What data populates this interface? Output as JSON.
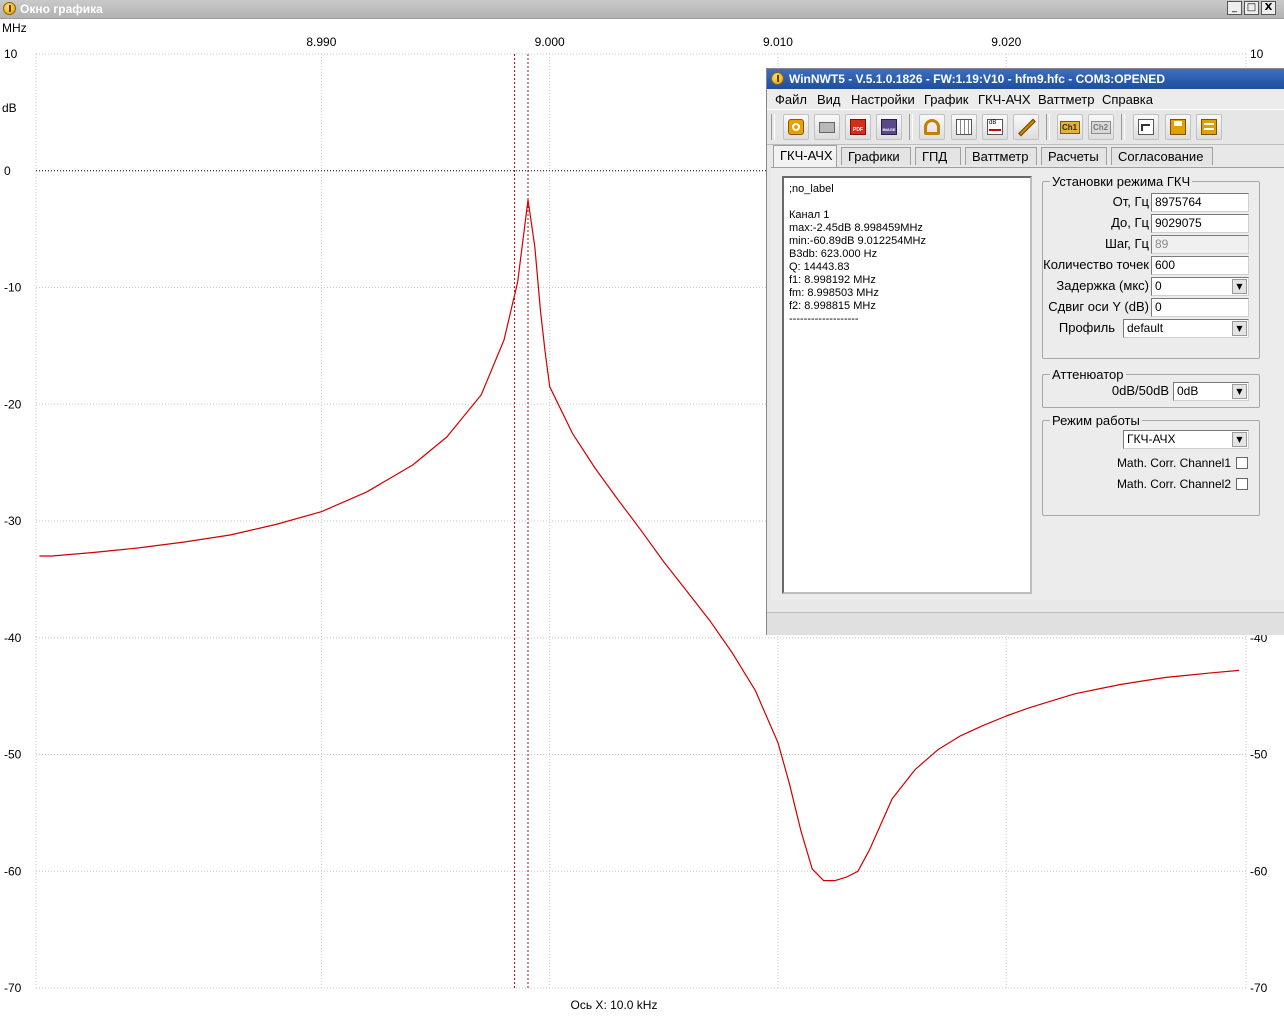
{
  "graph_window": {
    "title": "Окно графика",
    "controls": {
      "minimize": "_",
      "maximize": "□",
      "close": "X"
    }
  },
  "chart_data": {
    "type": "line",
    "x_unit_label": "MHz",
    "y_unit_label": "dB",
    "xlabel": "Ось X: 10.0 kHz",
    "xlim": [
      8.9775,
      9.0305
    ],
    "ylim": [
      -70,
      10
    ],
    "x_ticks": [
      8.99,
      9.0,
      9.01,
      9.02
    ],
    "x_tick_labels": [
      "8.990",
      "9.000",
      "9.010",
      "9.020"
    ],
    "y_ticks": [
      10,
      0,
      -10,
      -20,
      -30,
      -40,
      -50,
      -60,
      -70
    ],
    "y_tick_labels": [
      "10",
      "0",
      "-10",
      "-20",
      "-30",
      "-40",
      "-50",
      "-60",
      "-70"
    ],
    "grid": true,
    "markers_x": [
      8.99846,
      8.99905
    ],
    "series": [
      {
        "color": "#d00000",
        "x": [
          8.97765,
          8.9782,
          8.98,
          8.982,
          8.984,
          8.986,
          8.988,
          8.99,
          8.992,
          8.994,
          8.9955,
          8.997,
          8.998,
          8.9986,
          8.99905,
          8.99935,
          8.9996,
          8.9998,
          9.0,
          9.001,
          9.002,
          9.003,
          9.004,
          9.005,
          9.006,
          9.007,
          9.008,
          9.009,
          9.01,
          9.0105,
          9.011,
          9.0115,
          9.012,
          9.0125,
          9.013,
          9.0135,
          9.014,
          9.015,
          9.016,
          9.017,
          9.018,
          9.019,
          9.02,
          9.021,
          9.022,
          9.023,
          9.024,
          9.025,
          9.026,
          9.027,
          9.028,
          9.029,
          9.0302
        ],
        "y": [
          -33.0,
          -33.0,
          -32.7,
          -32.3,
          -31.8,
          -31.2,
          -30.3,
          -29.2,
          -27.5,
          -25.2,
          -22.8,
          -19.2,
          -14.5,
          -9.5,
          -2.5,
          -6.5,
          -12.0,
          -15.5,
          -18.5,
          -22.5,
          -25.5,
          -28.2,
          -30.8,
          -33.5,
          -36.0,
          -38.5,
          -41.3,
          -44.5,
          -49.0,
          -52.5,
          -56.5,
          -59.8,
          -60.8,
          -60.8,
          -60.5,
          -60.0,
          -58.2,
          -53.8,
          -51.3,
          -49.6,
          -48.4,
          -47.5,
          -46.7,
          -46.0,
          -45.4,
          -44.8,
          -44.4,
          -44.0,
          -43.7,
          -43.4,
          -43.2,
          -43.0,
          -42.8
        ]
      }
    ]
  },
  "nwt_window": {
    "title": "WinNWT5 - V.5.1.0.1826 - FW:1.19:V10 - hfm9.hfc - COM3:OPENED",
    "menu": [
      "Файл",
      "Вид",
      "Настройки",
      "График",
      "ГКЧ-АЧХ",
      "Ваттметр",
      "Справка"
    ],
    "toolbar": {
      "ch1": "Ch1",
      "ch2": "Ch2",
      "pdf": "PDF",
      "image": "IMAGE",
      "db": "dB"
    },
    "tabs": [
      "ГКЧ-АЧХ",
      "Графики",
      "ГПД",
      "Ваттметр",
      "Расчеты",
      "Согласование"
    ],
    "info_lines": [
      ";no_label",
      "",
      "Канал 1",
      "max:-2.45dB 8.998459MHz",
      "min:-60.89dB 9.012254MHz",
      "B3db: 623.000 Hz",
      "Q: 14443.83",
      "f1: 8.998192 MHz",
      "fm: 8.998503 MHz",
      "f2: 8.998815 MHz",
      "-------------------"
    ],
    "sweep": {
      "legend": "Установки режима ГКЧ",
      "from_label": "От, Гц",
      "from_value": "8975764",
      "to_label": "До, Гц",
      "to_value": "9029075",
      "step_label": "Шаг, Гц",
      "step_value": "89",
      "points_label": "Количество точек",
      "points_value": "600",
      "delay_label": "Задержка (мкс)",
      "delay_value": "0",
      "yshift_label": "Сдвиг оси Y (dB)",
      "yshift_value": "0",
      "profile_label": "Профиль",
      "profile_value": "default"
    },
    "attenuator": {
      "legend": "Аттенюатор",
      "label": "0dB/50dB",
      "value": "0dB"
    },
    "mode": {
      "legend": "Режим работы",
      "value": "ГКЧ-АЧХ",
      "math1_label": "Math. Corr. Channel1",
      "math2_label": "Math. Corr. Channel2"
    }
  }
}
